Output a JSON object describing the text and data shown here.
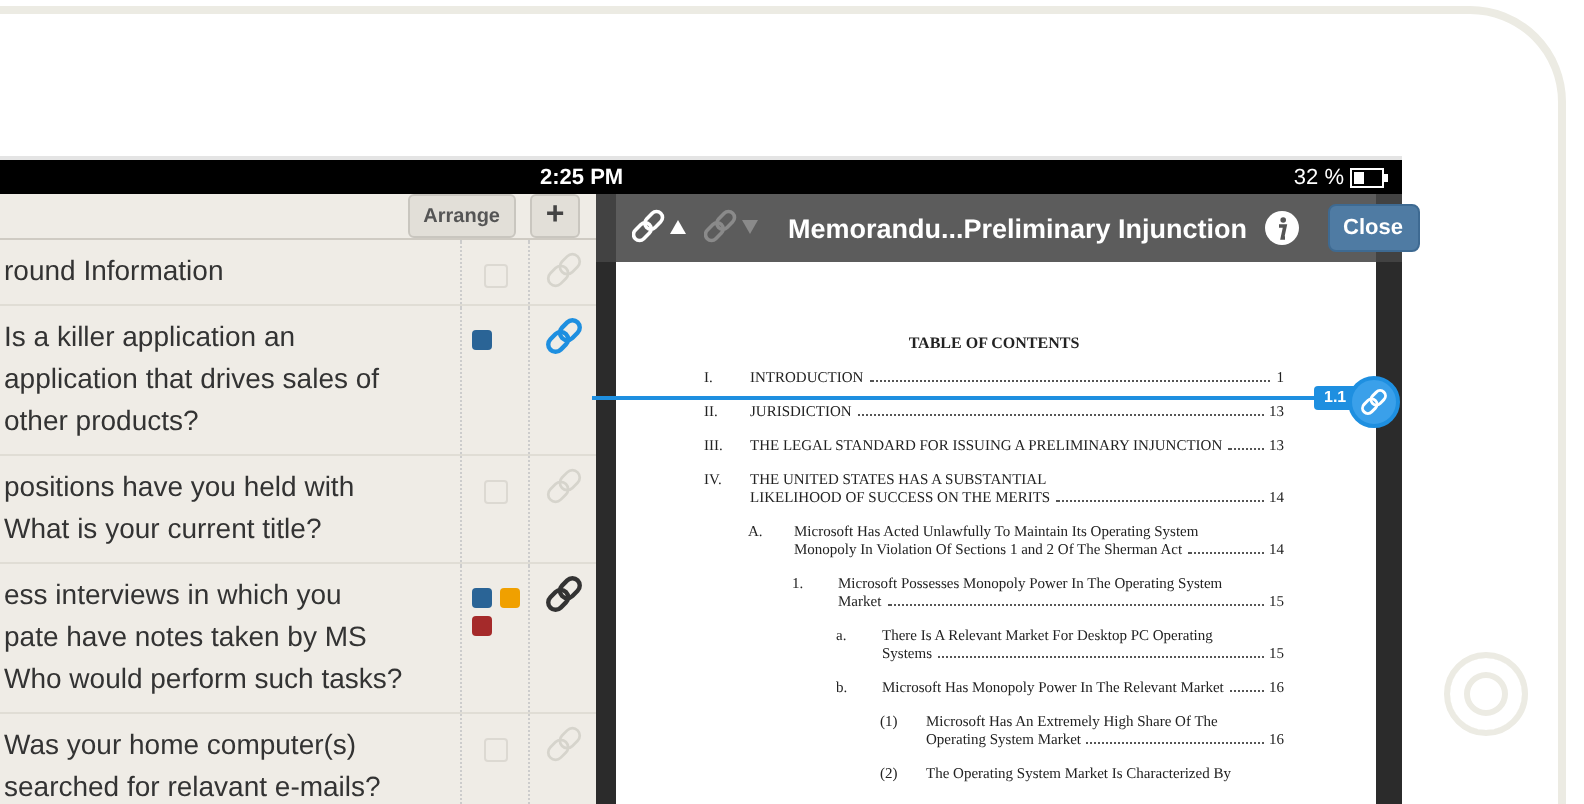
{
  "status_bar": {
    "time": "2:25 PM",
    "battery": "32 %"
  },
  "list_header": {
    "arrange_label": "Arrange",
    "add_label": "+"
  },
  "rows": [
    {
      "lines": [
        "round Information"
      ],
      "checked": false,
      "linked": false,
      "selected": false
    },
    {
      "lines": [
        "Is a killer application an",
        "application that drives sales of",
        "other products?"
      ],
      "tags": [
        {
          "color": "#2a6496"
        }
      ],
      "linked": true,
      "selected": true
    },
    {
      "lines": [
        "positions have you held with",
        "What is your current title?"
      ],
      "checked": false,
      "linked": false,
      "selected": false
    },
    {
      "lines": [
        "ess interviews in which you",
        "pate have notes taken by MS",
        "Who would perform such tasks?"
      ],
      "tags": [
        {
          "color": "#2a6496"
        },
        {
          "color": "#f0a000"
        },
        {
          "color": "#a52a2a"
        }
      ],
      "linked": true,
      "selected": false
    },
    {
      "lines": [
        "Was your home computer(s)",
        "searched for relavant e-mails?"
      ],
      "checked": false,
      "linked": false,
      "selected": false
    }
  ],
  "viewer_toolbar": {
    "link_buttons": [
      {
        "disabled": false
      },
      {
        "disabled": true
      }
    ],
    "title": "Memorandu...Preliminary Injunction",
    "close_label": "Close"
  },
  "document": {
    "toc_title": "TABLE OF CONTENTS",
    "entries": [
      {
        "number": "I.",
        "lines": [
          "INTRODUCTION"
        ],
        "page": "1"
      },
      {
        "number": "II.",
        "lines": [
          "JURISDICTION"
        ],
        "page": "13"
      },
      {
        "number": "III.",
        "lines": [
          "THE LEGAL STANDARD FOR ISSUING A PRELIMINARY INJUNCTION"
        ],
        "page": "13"
      },
      {
        "number": "IV.",
        "lines": [
          "THE UNITED STATES HAS A SUBSTANTIAL",
          "LIKELIHOOD OF SUCCESS ON THE MERITS"
        ],
        "page": "14",
        "children": [
          {
            "number": "A.",
            "lines": [
              "Microsoft Has Acted Unlawfully To Maintain Its Operating System",
              "Monopoly In Violation Of Sections 1 and 2 Of The Sherman Act"
            ],
            "page": "14",
            "children": [
              {
                "number": "1.",
                "lines": [
                  "Microsoft Possesses Monopoly Power In The Operating System",
                  "Market"
                ],
                "page": "15",
                "children": [
                  {
                    "number": "a.",
                    "lines": [
                      "There Is A Relevant Market For Desktop PC Operating",
                      "Systems"
                    ],
                    "page": "15"
                  },
                  {
                    "number": "b.",
                    "lines": [
                      "Microsoft Has Monopoly Power In The Relevant Market"
                    ],
                    "page": "16",
                    "children": [
                      {
                        "number": "(1)",
                        "lines": [
                          "Microsoft Has An Extremely High Share Of The",
                          "Operating System Market"
                        ],
                        "page": "16"
                      },
                      {
                        "number": "(2)",
                        "lines": [
                          "The Operating System Market Is Characterized By"
                        ]
                      }
                    ]
                  }
                ]
              }
            ]
          }
        ]
      }
    ],
    "link_marker": {
      "label": "1.1"
    }
  }
}
